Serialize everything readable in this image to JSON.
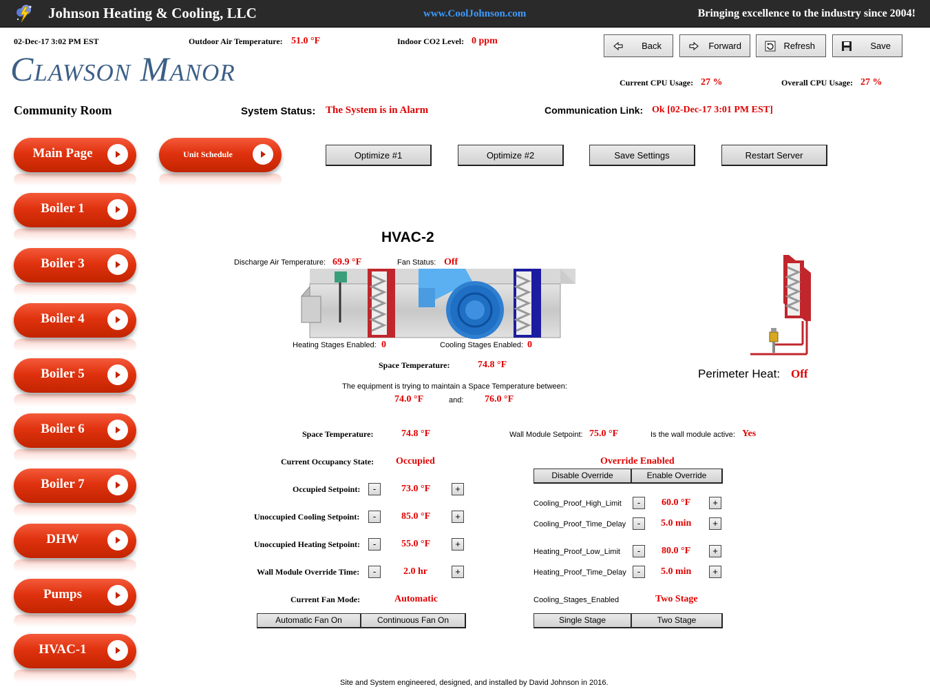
{
  "header": {
    "company": "Johnson Heating & Cooling, LLC",
    "url": "www.CoolJohnson.com",
    "tagline": "Bringing excellence to the industry since 2004!"
  },
  "info": {
    "datetime": "02-Dec-17 3:02 PM EST",
    "outdoor_label": "Outdoor Air Temperature:",
    "outdoor_value": "51.0 °F",
    "co2_label": "Indoor CO2 Level:",
    "co2_value": "0 ppm",
    "site_name": "Clawson Manor",
    "room_name": "Community Room",
    "cpu_label": "Current CPU Usage:",
    "cpu_value": "27 %",
    "overall_cpu_label": "Overall CPU Usage:",
    "overall_cpu_value": "27 %",
    "status_label": "System Status:",
    "status_value": "The System is in Alarm",
    "comm_label": "Communication Link:",
    "comm_value": "Ok [02-Dec-17 3:01 PM EST]"
  },
  "toolbar": {
    "back": "Back",
    "forward": "Forward",
    "refresh": "Refresh",
    "save": "Save"
  },
  "actions": {
    "optimize1": "Optimize #1",
    "optimize2": "Optimize #2",
    "save_settings": "Save Settings",
    "restart": "Restart Server"
  },
  "nav": {
    "main": "Main Page",
    "schedule": "Unit Schedule",
    "items": [
      "Boiler 1",
      "Boiler 3",
      "Boiler 4",
      "Boiler 5",
      "Boiler 6",
      "Boiler 7",
      "DHW",
      "Pumps",
      "HVAC-1"
    ]
  },
  "unit": {
    "title": "HVAC-2",
    "discharge_label": "Discharge Air Temperature:",
    "discharge_value": "69.9 °F",
    "fan_label": "Fan Status:",
    "fan_value": "Off",
    "heating_stages_label": "Heating Stages Enabled:",
    "heating_stages_value": "0",
    "cooling_stages_label": "Cooling Stages Enabled:",
    "cooling_stages_value": "0",
    "space_label": "Space Temperature:",
    "space_value": "74.8 °F",
    "maintain_text": "The equipment is trying to maintain a Space Temperature between:",
    "range_low": "74.0 °F",
    "range_and": "and:",
    "range_high": "76.0 °F",
    "perimeter_label": "Perimeter Heat:",
    "perimeter_value": "Off"
  },
  "settings": {
    "space_label": "Space Temperature:",
    "space_value": "74.8 °F",
    "wall_sp_label": "Wall Module Setpoint:",
    "wall_sp_value": "75.0 °F",
    "wall_active_label": "Is the wall module active:",
    "wall_active_value": "Yes",
    "occ_state_label": "Current Occupancy State:",
    "occ_state_value": "Occupied",
    "override_status": "Override Enabled",
    "disable_override": "Disable Override",
    "enable_override": "Enable Override",
    "occ_sp_label": "Occupied Setpoint:",
    "occ_sp_value": "73.0 °F",
    "unocc_cool_label": "Unoccupied Cooling Setpoint:",
    "unocc_cool_value": "85.0 °F",
    "unocc_heat_label": "Unoccupied Heating Setpoint:",
    "unocc_heat_value": "55.0 °F",
    "override_time_label": "Wall Module Override Time:",
    "override_time_value": "2.0 hr",
    "cool_high_label": "Cooling_Proof_High_Limit",
    "cool_high_value": "60.0 °F",
    "cool_delay_label": "Cooling_Proof_Time_Delay",
    "cool_delay_value": "5.0 min",
    "heat_low_label": "Heating_Proof_Low_Limit",
    "heat_low_value": "80.0 °F",
    "heat_delay_label": "Heating_Proof_Time_Delay",
    "heat_delay_value": "5.0 min",
    "fan_mode_label": "Current Fan Mode:",
    "fan_mode_value": "Automatic",
    "auto_fan": "Automatic Fan On",
    "cont_fan": "Continuous Fan On",
    "cool_stages_label": "Cooling_Stages_Enabled",
    "cool_stages_value": "Two Stage",
    "single_stage": "Single Stage",
    "two_stage": "Two Stage",
    "minus": "-",
    "plus": "+"
  },
  "footer": {
    "text": "Site and System engineered, designed, and installed by David Johnson in 2016."
  },
  "colors": {
    "alarm_red": "#e00000",
    "url_blue": "#3d9bff",
    "nav_red": "#e0320f",
    "topbar": "#2a2a2a"
  }
}
